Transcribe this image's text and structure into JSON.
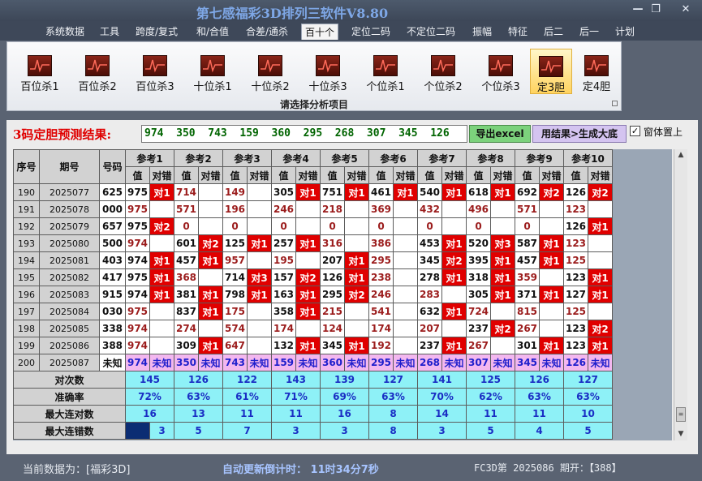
{
  "window": {
    "title": "第七感福彩3D排列三软件V8.80",
    "min_label": "—",
    "max_label": "❐",
    "close_label": "✕"
  },
  "menu": [
    {
      "label": "系统数据"
    },
    {
      "label": "工具"
    },
    {
      "label": "跨度/复式"
    },
    {
      "label": "和/合值"
    },
    {
      "label": "合差/通杀"
    },
    {
      "label": "百十个"
    },
    {
      "label": "定位二码"
    },
    {
      "label": "不定位二码"
    },
    {
      "label": "振幅"
    },
    {
      "label": "特征"
    },
    {
      "label": "后二"
    },
    {
      "label": "后一"
    },
    {
      "label": "计划"
    }
  ],
  "ribbon": {
    "buttons": [
      {
        "label": "百位杀1"
      },
      {
        "label": "百位杀2"
      },
      {
        "label": "百位杀3"
      },
      {
        "label": "十位杀1"
      },
      {
        "label": "十位杀2"
      },
      {
        "label": "十位杀3"
      },
      {
        "label": "个位杀1"
      },
      {
        "label": "个位杀2"
      },
      {
        "label": "个位杀3"
      },
      {
        "label": "定3胆"
      },
      {
        "label": "定4胆"
      }
    ],
    "caption": "请选择分析项目"
  },
  "prediction": {
    "label": "3码定胆预测结果:",
    "value": "974  350  743  159  360  295  268  307  345  126",
    "export_button": "导出excel",
    "generate_button": "用结果>生成大底",
    "pin_checkbox": "✓",
    "pin_label": "窗体置上"
  },
  "grid": {
    "headers": {
      "seq": "序号",
      "period": "期号",
      "number": "号码"
    },
    "ref_headers": [
      "参考1",
      "参考2",
      "参考3",
      "参考4",
      "参考5",
      "参考6",
      "参考7",
      "参考8",
      "参考9",
      "参考10"
    ],
    "sub_value": "值",
    "sub_result": "对错",
    "rows": [
      {
        "seq": "190",
        "period": "2025077",
        "number": "625",
        "cells": [
          [
            "975",
            "对1"
          ],
          [
            "714",
            ""
          ],
          [
            "149",
            ""
          ],
          [
            "305",
            "对1"
          ],
          [
            "751",
            "对1"
          ],
          [
            "461",
            "对1"
          ],
          [
            "540",
            "对1"
          ],
          [
            "618",
            "对1"
          ],
          [
            "692",
            "对2"
          ],
          [
            "126",
            "对2"
          ]
        ]
      },
      {
        "seq": "191",
        "period": "2025078",
        "number": "000",
        "cells": [
          [
            "975",
            ""
          ],
          [
            "571",
            ""
          ],
          [
            "196",
            ""
          ],
          [
            "246",
            ""
          ],
          [
            "218",
            ""
          ],
          [
            "369",
            ""
          ],
          [
            "432",
            ""
          ],
          [
            "496",
            ""
          ],
          [
            "571",
            ""
          ],
          [
            "123",
            ""
          ]
        ]
      },
      {
        "seq": "192",
        "period": "2025079",
        "number": "657",
        "cells": [
          [
            "975",
            "对2"
          ],
          [
            "0",
            ""
          ],
          [
            "0",
            ""
          ],
          [
            "0",
            ""
          ],
          [
            "0",
            ""
          ],
          [
            "0",
            ""
          ],
          [
            "0",
            ""
          ],
          [
            "0",
            ""
          ],
          [
            "0",
            ""
          ],
          [
            "126",
            "对1"
          ]
        ]
      },
      {
        "seq": "193",
        "period": "2025080",
        "number": "500",
        "cells": [
          [
            "974",
            ""
          ],
          [
            "601",
            "对2"
          ],
          [
            "125",
            "对1"
          ],
          [
            "257",
            "对1"
          ],
          [
            "316",
            ""
          ],
          [
            "386",
            ""
          ],
          [
            "453",
            "对1"
          ],
          [
            "520",
            "对3"
          ],
          [
            "587",
            "对1"
          ],
          [
            "123",
            ""
          ]
        ]
      },
      {
        "seq": "194",
        "period": "2025081",
        "number": "403",
        "cells": [
          [
            "974",
            "对1"
          ],
          [
            "457",
            "对1"
          ],
          [
            "957",
            ""
          ],
          [
            "195",
            ""
          ],
          [
            "207",
            "对1"
          ],
          [
            "295",
            ""
          ],
          [
            "345",
            "对2"
          ],
          [
            "395",
            "对1"
          ],
          [
            "457",
            "对1"
          ],
          [
            "125",
            ""
          ]
        ]
      },
      {
        "seq": "195",
        "period": "2025082",
        "number": "417",
        "cells": [
          [
            "975",
            "对1"
          ],
          [
            "368",
            ""
          ],
          [
            "714",
            "对3"
          ],
          [
            "157",
            "对2"
          ],
          [
            "126",
            "对1"
          ],
          [
            "238",
            ""
          ],
          [
            "278",
            "对1"
          ],
          [
            "318",
            "对1"
          ],
          [
            "359",
            ""
          ],
          [
            "123",
            "对1"
          ]
        ]
      },
      {
        "seq": "196",
        "period": "2025083",
        "number": "915",
        "cells": [
          [
            "974",
            "对1"
          ],
          [
            "381",
            "对1"
          ],
          [
            "798",
            "对1"
          ],
          [
            "163",
            "对1"
          ],
          [
            "295",
            "对2"
          ],
          [
            "246",
            ""
          ],
          [
            "283",
            ""
          ],
          [
            "305",
            "对1"
          ],
          [
            "371",
            "对1"
          ],
          [
            "127",
            "对1"
          ]
        ]
      },
      {
        "seq": "197",
        "period": "2025084",
        "number": "030",
        "cells": [
          [
            "975",
            ""
          ],
          [
            "837",
            "对1"
          ],
          [
            "175",
            ""
          ],
          [
            "358",
            "对1"
          ],
          [
            "215",
            ""
          ],
          [
            "541",
            ""
          ],
          [
            "632",
            "对1"
          ],
          [
            "724",
            ""
          ],
          [
            "815",
            ""
          ],
          [
            "125",
            ""
          ]
        ]
      },
      {
        "seq": "198",
        "period": "2025085",
        "number": "338",
        "cells": [
          [
            "974",
            ""
          ],
          [
            "274",
            ""
          ],
          [
            "574",
            ""
          ],
          [
            "174",
            ""
          ],
          [
            "124",
            ""
          ],
          [
            "174",
            ""
          ],
          [
            "207",
            ""
          ],
          [
            "237",
            "对2"
          ],
          [
            "267",
            ""
          ],
          [
            "123",
            "对2"
          ]
        ]
      },
      {
        "seq": "199",
        "period": "2025086",
        "number": "388",
        "cells": [
          [
            "974",
            ""
          ],
          [
            "309",
            "对1"
          ],
          [
            "647",
            ""
          ],
          [
            "132",
            "对1"
          ],
          [
            "345",
            "对1"
          ],
          [
            "192",
            ""
          ],
          [
            "237",
            "对1"
          ],
          [
            "267",
            ""
          ],
          [
            "301",
            "对1"
          ],
          [
            "123",
            "对1"
          ]
        ]
      },
      {
        "seq": "200",
        "period": "2025087",
        "number": "未知",
        "cells": [
          [
            "974",
            "未知"
          ],
          [
            "350",
            "未知"
          ],
          [
            "743",
            "未知"
          ],
          [
            "159",
            "未知"
          ],
          [
            "360",
            "未知"
          ],
          [
            "295",
            "未知"
          ],
          [
            "268",
            "未知"
          ],
          [
            "307",
            "未知"
          ],
          [
            "345",
            "未知"
          ],
          [
            "126",
            "未知"
          ]
        ]
      }
    ],
    "stats": [
      {
        "label": "对次数",
        "values": [
          "145",
          "126",
          "122",
          "143",
          "139",
          "127",
          "141",
          "125",
          "126",
          "127"
        ]
      },
      {
        "label": "准确率",
        "values": [
          "72%",
          "63%",
          "61%",
          "71%",
          "69%",
          "63%",
          "70%",
          "62%",
          "63%",
          "63%"
        ]
      },
      {
        "label": "最大连对数",
        "values": [
          "16",
          "13",
          "11",
          "11",
          "16",
          "8",
          "14",
          "11",
          "11",
          "10"
        ]
      },
      {
        "label": "最大连错数",
        "values": [
          "3",
          "5",
          "7",
          "3",
          "3",
          "8",
          "3",
          "5",
          "4",
          "5"
        ]
      }
    ]
  },
  "status": {
    "current_data": "当前数据为：[福彩3D]",
    "countdown": "自动更新倒计时：  11时34分7秒",
    "issue": "FC3D第 2025086 期开：【388】"
  }
}
